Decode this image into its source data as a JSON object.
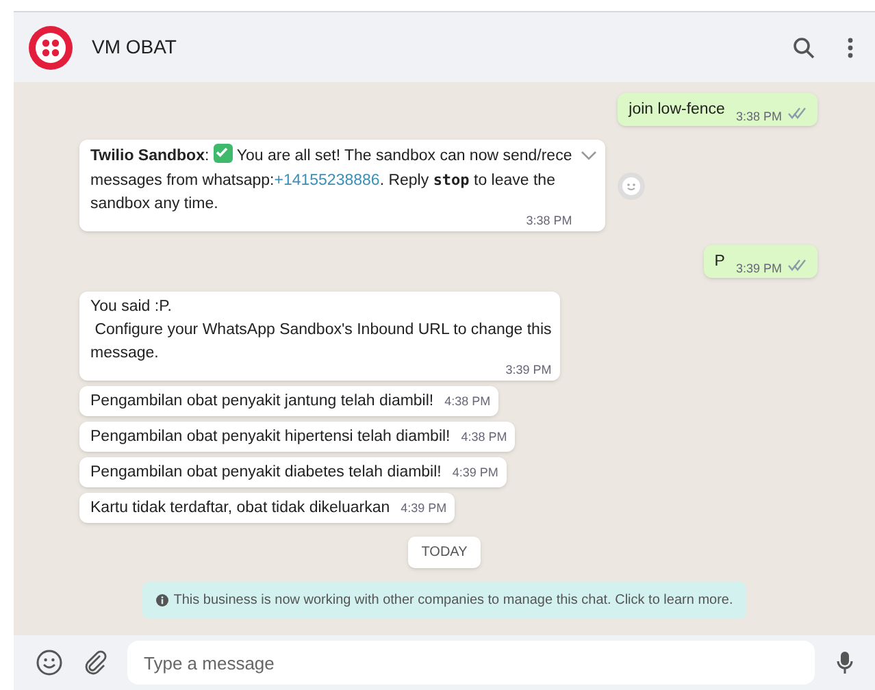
{
  "header": {
    "title": "VM OBAT"
  },
  "messages": [
    {
      "kind": "outgoing",
      "text": "join low-fence",
      "time": "3:38 PM",
      "read": true
    },
    {
      "kind": "incoming",
      "segments": [
        {
          "kind": "bold",
          "text": "Twilio Sandbox"
        },
        {
          "kind": "text",
          "text": ": "
        },
        {
          "kind": "check"
        },
        {
          "kind": "text",
          "text": " You are all set! The sandbox can now send/rece"
        },
        {
          "kind": "break"
        },
        {
          "kind": "text",
          "text": "messages from whatsapp:"
        },
        {
          "kind": "link",
          "text": "+14155238886"
        },
        {
          "kind": "text",
          "text": ". Reply "
        },
        {
          "kind": "code",
          "text": "stop"
        },
        {
          "kind": "text",
          "text": " to leave the"
        },
        {
          "kind": "break"
        },
        {
          "kind": "text",
          "text": "sandbox any time."
        }
      ],
      "time": "3:38 PM",
      "menu": true,
      "react": true
    },
    {
      "kind": "outgoing",
      "text": "P",
      "time": "3:39 PM",
      "read": true
    },
    {
      "kind": "incoming",
      "segments": [
        {
          "kind": "text",
          "text": "You said :P."
        },
        {
          "kind": "break"
        },
        {
          "kind": "text",
          "text": " Configure your WhatsApp Sandbox's Inbound URL to change this"
        },
        {
          "kind": "break"
        },
        {
          "kind": "text",
          "text": "message."
        }
      ],
      "time": "3:39 PM"
    },
    {
      "kind": "incoming",
      "segments": [
        {
          "kind": "text",
          "text": "Pengambilan obat penyakit jantung telah diambil!"
        }
      ],
      "time": "4:38 PM"
    },
    {
      "kind": "incoming",
      "segments": [
        {
          "kind": "text",
          "text": "Pengambilan obat penyakit hipertensi telah diambil!"
        }
      ],
      "time": "4:38 PM"
    },
    {
      "kind": "incoming",
      "segments": [
        {
          "kind": "text",
          "text": "Pengambilan obat penyakit diabetes telah diambil!"
        }
      ],
      "time": "4:39 PM"
    },
    {
      "kind": "incoming",
      "segments": [
        {
          "kind": "text",
          "text": "Kartu tidak terdaftar, obat tidak dikeluarkan"
        }
      ],
      "time": "4:39 PM"
    },
    {
      "kind": "date",
      "text": "TODAY"
    },
    {
      "kind": "system",
      "text": "This business is now working with other companies to manage this chat. Click to learn more."
    }
  ],
  "composer": {
    "placeholder": "Type a message"
  }
}
